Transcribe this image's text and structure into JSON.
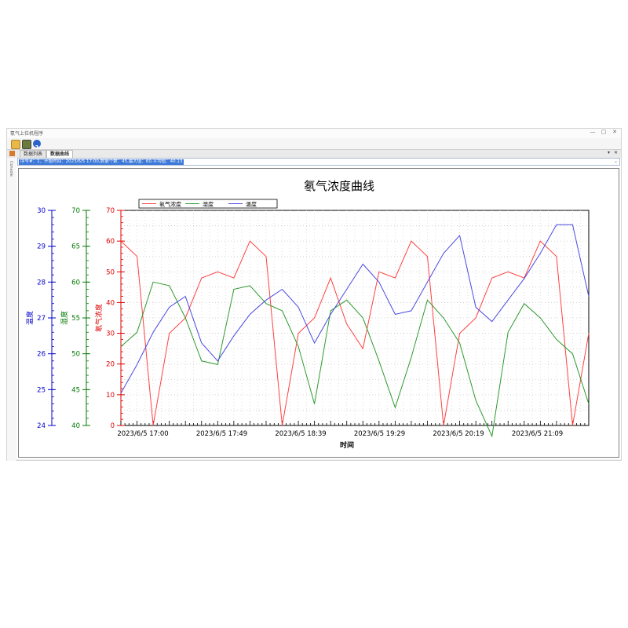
{
  "window": {
    "title": "氡气上位机程序",
    "controls": [
      "—",
      "▢",
      "✕"
    ]
  },
  "toolbar": {
    "icons": [
      "open-folder-icon",
      "export-icon",
      "help-icon"
    ]
  },
  "tabs": [
    {
      "label": "数据列表",
      "active": false
    },
    {
      "label": "数据曲线",
      "active": true
    }
  ],
  "tab_controls": {
    "dropdown": "▾",
    "close": "✕"
  },
  "sidebar": {
    "label": "Console"
  },
  "info": {
    "text": "序号#：1，开始时间：2023/6/5 17:00,数据个数：45,最大值：60,平均值：40.13",
    "dropdown": "⌄"
  },
  "colors": {
    "radon": "#ff4040",
    "humidity": "#2e9a2e",
    "temperature": "#4a4ae0"
  },
  "chart_data": {
    "type": "line",
    "title": "氡气浓度曲线",
    "xlabel": "时间",
    "x_tick_labels": [
      "2023/6/5 17:00",
      "2023/6/5 17:49",
      "2023/6/5 18:39",
      "2023/6/5 19:29",
      "2023/6/5 20:19",
      "2023/6/5 21:09"
    ],
    "x_minutes": [
      0,
      10,
      20,
      30,
      40,
      50,
      60,
      70,
      80,
      90,
      100,
      110,
      120,
      130,
      140,
      150,
      160,
      170,
      180,
      190,
      200,
      210,
      220,
      230,
      240,
      250,
      260,
      270,
      280,
      290
    ],
    "axes": [
      {
        "label": "温度",
        "color": "#0000cc",
        "min": 24,
        "max": 30,
        "ticks": [
          24,
          25,
          26,
          27,
          28,
          29,
          30
        ]
      },
      {
        "label": "湿度",
        "color": "#007700",
        "min": 40,
        "max": 70,
        "ticks": [
          40,
          45,
          50,
          55,
          60,
          65,
          70
        ]
      },
      {
        "label": "氡气浓度",
        "color": "#dd0000",
        "min": 0,
        "max": 70,
        "ticks": [
          0,
          10,
          20,
          30,
          40,
          50,
          60,
          70
        ]
      }
    ],
    "grid": true,
    "legend_position": "top-left",
    "series": [
      {
        "name": "氡气浓度",
        "axis": 2,
        "color": "#ff4040",
        "values": [
          60,
          55,
          0,
          30,
          35,
          48,
          50,
          48,
          60,
          55,
          0,
          30,
          35,
          48,
          33,
          25,
          50,
          48,
          60,
          55,
          0,
          30,
          35,
          48,
          50,
          48,
          60,
          55,
          0,
          30
        ]
      },
      {
        "name": "湿度",
        "axis": 1,
        "color": "#2e9a2e",
        "values": [
          51,
          53,
          60,
          59.5,
          55,
          49,
          48.5,
          59,
          59.5,
          57,
          56,
          51,
          43,
          56,
          57.5,
          55,
          49,
          42.5,
          49.5,
          57.5,
          55,
          51.5,
          43.5,
          38.5,
          53,
          57,
          55,
          52,
          50,
          43
        ]
      },
      {
        "name": "温度",
        "axis": 0,
        "color": "#4a4ae0",
        "values": [
          24.9,
          25.7,
          26.6,
          27.3,
          27.6,
          26.3,
          25.8,
          26.5,
          27.1,
          27.5,
          27.8,
          27.3,
          26.3,
          27.1,
          27.8,
          28.5,
          28,
          27.1,
          27.2,
          28,
          28.8,
          29.3,
          27.3,
          26.9,
          27.5,
          28.1,
          28.8,
          29.6,
          29.6,
          27.6
        ]
      }
    ]
  }
}
